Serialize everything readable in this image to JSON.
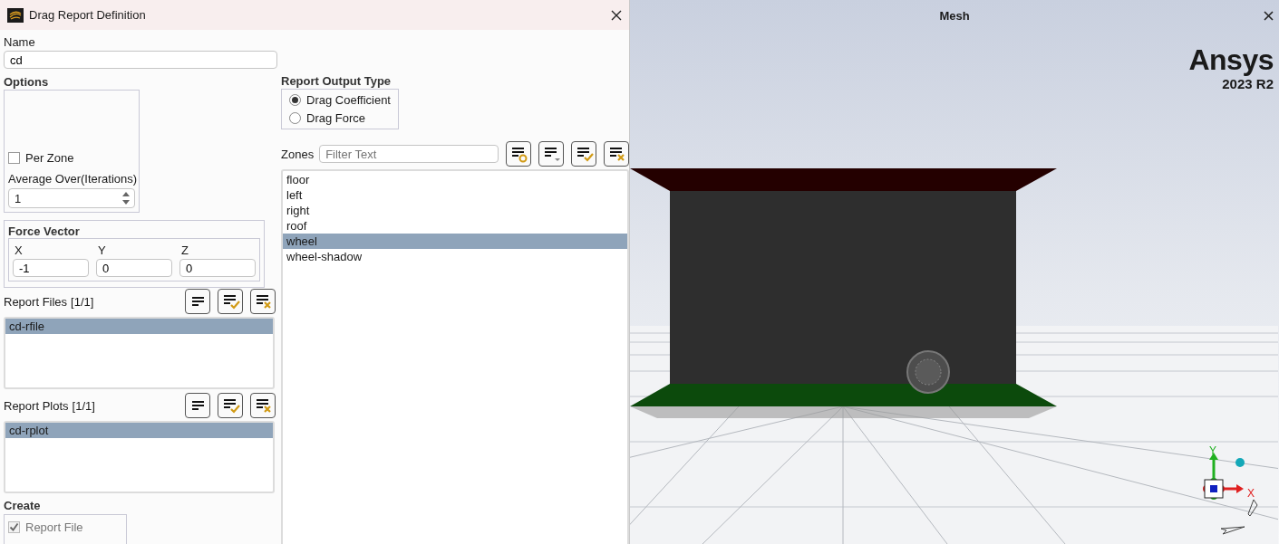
{
  "dialog": {
    "title": "Drag Report Definition",
    "name": {
      "label": "Name",
      "value": "cd"
    },
    "options": {
      "title": "Options",
      "per_zone": {
        "label": "Per Zone",
        "checked": false
      },
      "average": {
        "label": "Average Over(Iterations)",
        "value": "1"
      }
    },
    "force_vector": {
      "title": "Force Vector",
      "components": [
        {
          "label": "X",
          "value": "-1"
        },
        {
          "label": "Y",
          "value": "0"
        },
        {
          "label": "Z",
          "value": "0"
        }
      ]
    },
    "report_files": {
      "label": "Report Files",
      "count": "[1/1]",
      "items": [
        {
          "label": "cd-rfile",
          "selected": true
        }
      ]
    },
    "report_plots": {
      "label": "Report Plots",
      "count": "[1/1]",
      "items": [
        {
          "label": "cd-rplot",
          "selected": true
        }
      ]
    },
    "create": {
      "title": "Create",
      "items": [
        {
          "label": "Report File",
          "checked": true,
          "disabled": true
        }
      ]
    },
    "report_output_type": {
      "title": "Report Output Type",
      "options": [
        {
          "label": "Drag Coefficient",
          "selected": true
        },
        {
          "label": "Drag Force",
          "selected": false
        }
      ]
    },
    "zones": {
      "label": "Zones",
      "filter_placeholder": "Filter Text",
      "items": [
        {
          "label": "floor",
          "selected": false
        },
        {
          "label": "left",
          "selected": false
        },
        {
          "label": "right",
          "selected": false
        },
        {
          "label": "roof",
          "selected": false
        },
        {
          "label": "wheel",
          "selected": true
        },
        {
          "label": "wheel-shadow",
          "selected": false
        }
      ]
    }
  },
  "viewport": {
    "title": "Mesh",
    "logo": "Ansys",
    "version": "2023 R2",
    "triad": {
      "x_label": "X",
      "y_label": "Y"
    }
  }
}
